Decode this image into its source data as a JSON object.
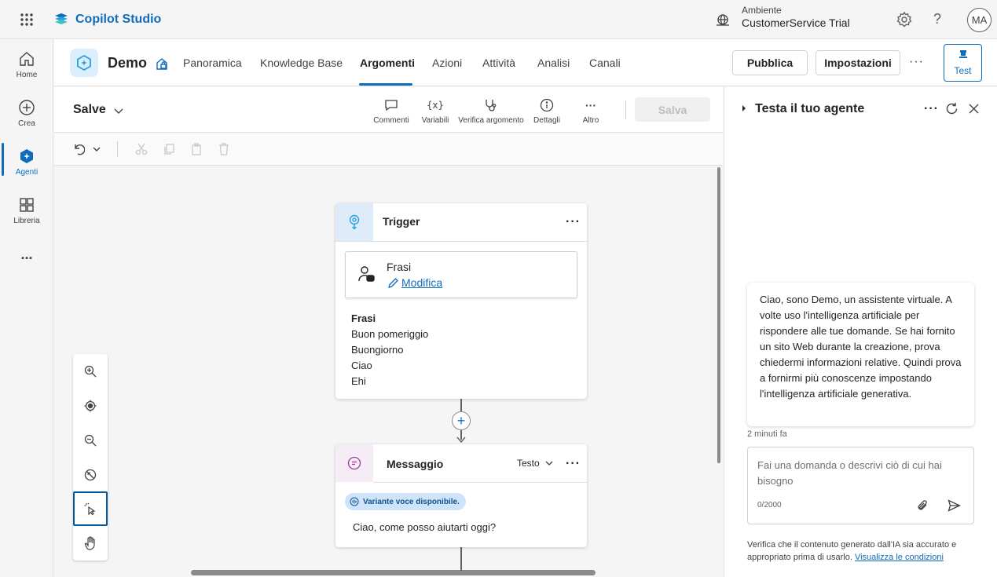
{
  "app": {
    "title": "Copilot Studio",
    "environment_label": "Ambiente",
    "environment_value": "CustomerService Trial",
    "avatar_initials": "MA",
    "help_glyph": "?"
  },
  "rail": [
    {
      "label": "Home",
      "icon": "home-icon"
    },
    {
      "label": "Crea",
      "icon": "add-circle-icon"
    },
    {
      "label": "Agenti",
      "icon": "agents-icon",
      "active": true
    },
    {
      "label": "Libreria",
      "icon": "library-icon"
    },
    {
      "label": "...",
      "icon": "more-icon"
    }
  ],
  "agent": {
    "name": "Demo",
    "tabs": [
      "Panoramica",
      "Knowledge Base",
      "Argomenti",
      "Azioni",
      "Attività",
      "Analisi",
      "Canali"
    ],
    "active_tab": "Argomenti",
    "publish_label": "Pubblica",
    "settings_label": "Impostazioni",
    "more_label": "···",
    "test_label": "Test"
  },
  "topic": {
    "name": "Salve",
    "tools": [
      "Commenti",
      "Variabili",
      "Verifica argomento",
      "Dettagli",
      "Altro"
    ],
    "save_label": "Salva"
  },
  "trigger": {
    "title": "Trigger",
    "more": "···",
    "card_title": "Frasi",
    "edit_label": "Modifica",
    "phrases_heading": "Frasi",
    "phrases": [
      "Buon pomeriggio",
      "Buongiorno",
      "Ciao",
      "Ehi"
    ]
  },
  "message": {
    "title": "Messaggio",
    "type": "Testo",
    "more": "···",
    "badge": "Variante voce disponibile.",
    "text": "Ciao, come posso aiutarti oggi?",
    "add_glyph": "+"
  },
  "test_panel": {
    "title": "Testa il tuo agente",
    "more": "···",
    "bot_message": "Ciao, sono Demo, un assistente virtuale. A volte uso l'intelligenza artificiale per rispondere alle tue domande. Se hai fornito un sito Web durante la creazione, prova chiedermi informazioni relative. Quindi prova a fornirmi più conoscenze impostando l'intelligenza artificiale generativa.",
    "timestamp": "2 minuti fa",
    "input_placeholder": "Fai una domanda o descrivi ciò di cui hai bisogno",
    "char_count": "0/2000",
    "disclaimer": "Verifica che il contenuto generato dall'IA sia accurato e appropriato prima di usarlo.",
    "disclaimer_link": "Visualizza le condizioni"
  },
  "colors": {
    "accent": "#0f6cbd",
    "trigger_icon_bg": "#deecf9",
    "message_icon_bg": "#f5ecf5"
  }
}
